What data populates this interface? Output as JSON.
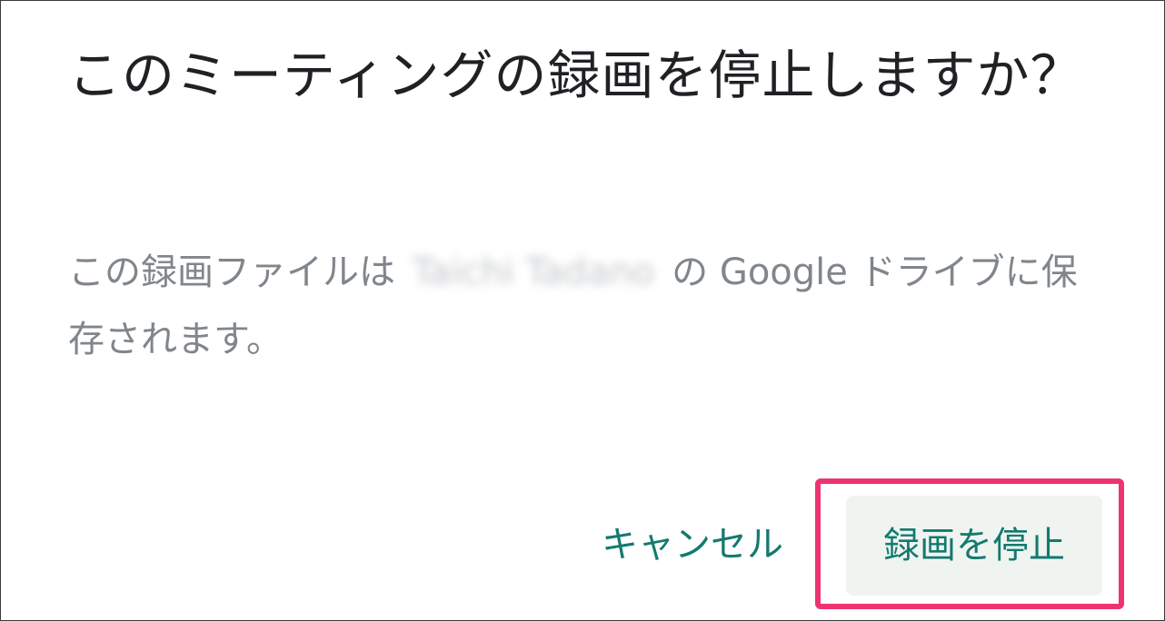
{
  "dialog": {
    "title": "このミーティングの録画を停止しますか？",
    "message_before_name": "この録画ファイルは ",
    "owner_name_redacted": "Taichi Tadano",
    "message_after_name": " の Google ドライブに保存されます。",
    "cancel_label": "キャンセル",
    "confirm_label": "録画を停止"
  },
  "colors": {
    "title_text": "#202124",
    "message_text": "#80868b",
    "button_text": "#137a6e",
    "confirm_button_background": "#f0f4f1",
    "highlight_border": "#ee3470"
  }
}
